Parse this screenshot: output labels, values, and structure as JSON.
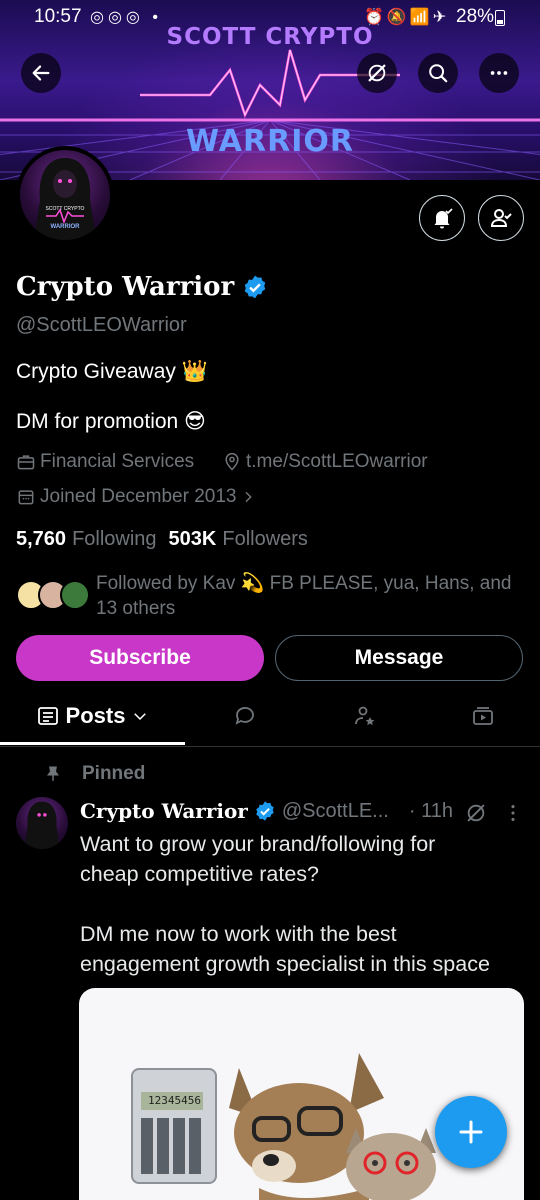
{
  "status_bar": {
    "time": "10:57",
    "battery": "28%"
  },
  "banner": {
    "title_top": "SCOTT CRYPTO",
    "title_bottom": "WARRIOR"
  },
  "avatar": {
    "text_top": "SCOTT CRYPTO",
    "text_bottom": "WARRIOR"
  },
  "profile": {
    "display_name": "Crypto Warrior",
    "handle": "@ScottLEOWarrior",
    "bio_line1": "Crypto Giveaway 👑",
    "bio_line2": "DM for promotion 😎",
    "category": "Financial Services",
    "link": "t.me/ScottLEOwarrior",
    "joined": "Joined December 2013",
    "following_count": "5,760",
    "following_label": "Following",
    "followers_count": "503K",
    "followers_label": "Followers",
    "followed_by_line1": "Followed by Kav 💫 FB PLEASE, yua, Hans, and",
    "followed_by_line2": "13 others"
  },
  "actions": {
    "subscribe_label": "Subscribe",
    "message_label": "Message"
  },
  "tabs": {
    "posts_label": "Posts"
  },
  "pinned_post": {
    "pinned_label": "Pinned",
    "author_name": "Crypto Warrior",
    "author_handle": "@ScottLE...",
    "time": "· 11h",
    "line1": "Want to grow your brand/following for",
    "line2": "cheap competitive rates?",
    "line3": "DM me now to work with the best",
    "line4": "engagement growth specialist in this space"
  },
  "media": {
    "calculator_display": "12345456"
  },
  "colors": {
    "subscribe": "#c837c8",
    "verified": "#1d9bf0",
    "fab": "#1d9bf0",
    "muted_text": "#71767b"
  },
  "icons": [
    "back-arrow-icon",
    "grok-icon",
    "search-icon",
    "more-icon",
    "bell-icon",
    "user-check-icon",
    "verified-icon",
    "briefcase-icon",
    "location-icon",
    "calendar-icon",
    "chevron-right-icon",
    "posts-icon",
    "chevron-down-icon",
    "reply-icon",
    "highlights-icon",
    "media-icon",
    "pin-icon",
    "plus-icon"
  ]
}
